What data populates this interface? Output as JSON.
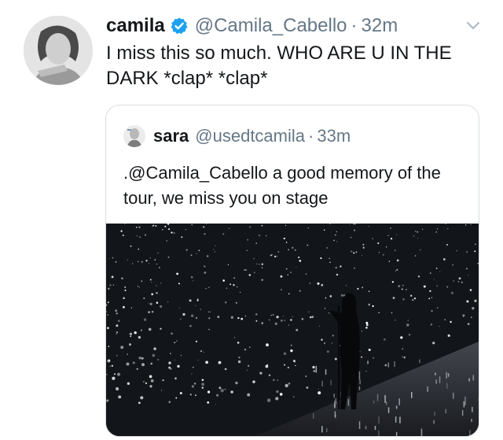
{
  "tweet": {
    "display_name": "camila",
    "handle": "@Camila_Cabello",
    "separator": "·",
    "time": "32m",
    "text": "I miss this so much. WHO ARE U IN THE DARK *clap* *clap*"
  },
  "quoted_tweet": {
    "display_name": "sara",
    "handle": "@usedtcamila",
    "separator": "·",
    "time": "33m",
    "text": ".@Camila_Cabello a good memory of the tour, we miss you on stage"
  },
  "colors": {
    "text": "#14171a",
    "secondary": "#657786",
    "verified": "#1da1f2",
    "border": "#d9dee2"
  },
  "icons": {
    "verified": "verified-badge-icon",
    "more": "chevron-down-icon"
  }
}
